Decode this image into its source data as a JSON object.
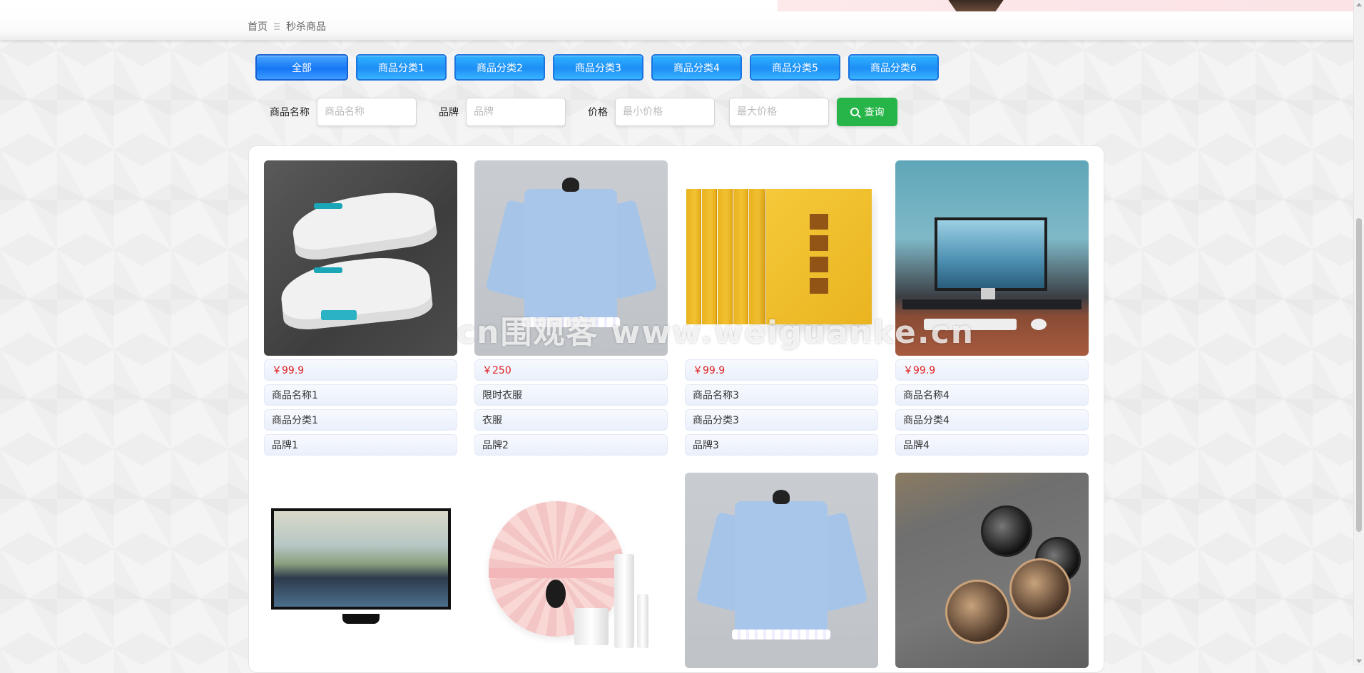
{
  "breadcrumb": {
    "home": "首页",
    "current": "秒杀商品"
  },
  "tabs": [
    {
      "label": "全部",
      "active": true
    },
    {
      "label": "商品分类1"
    },
    {
      "label": "商品分类2"
    },
    {
      "label": "商品分类3"
    },
    {
      "label": "商品分类4"
    },
    {
      "label": "商品分类5"
    },
    {
      "label": "商品分类6"
    }
  ],
  "search": {
    "name_label": "商品名称",
    "name_placeholder": "商品名称",
    "brand_label": "品牌",
    "brand_placeholder": "品牌",
    "price_label": "价格",
    "min_placeholder": "最小价格",
    "max_placeholder": "最大价格",
    "query_label": "查询"
  },
  "products": [
    {
      "price": "￥99.9",
      "name": "商品名称1",
      "category": "商品分类1",
      "brand": "品牌1",
      "image": "sneakers"
    },
    {
      "price": "￥250",
      "name": "限时衣服",
      "category": "衣服",
      "brand": "品牌2",
      "image": "blue-blouse"
    },
    {
      "price": "￥99.9",
      "name": "商品名称3",
      "category": "商品分类3",
      "brand": "品牌3",
      "image": "book-set"
    },
    {
      "price": "￥99.9",
      "name": "商品名称4",
      "category": "商品分类4",
      "brand": "品牌4",
      "image": "desk-monitor"
    },
    {
      "image": "television"
    },
    {
      "image": "cosmetics-cushion"
    },
    {
      "image": "blue-blouse"
    },
    {
      "image": "sunglasses"
    }
  ],
  "watermark": "cn围观客 www.weiguanke.cn",
  "colors": {
    "tab_blue": "#1e8ff5",
    "query_green": "#27b54a",
    "price_red": "#e02020"
  }
}
